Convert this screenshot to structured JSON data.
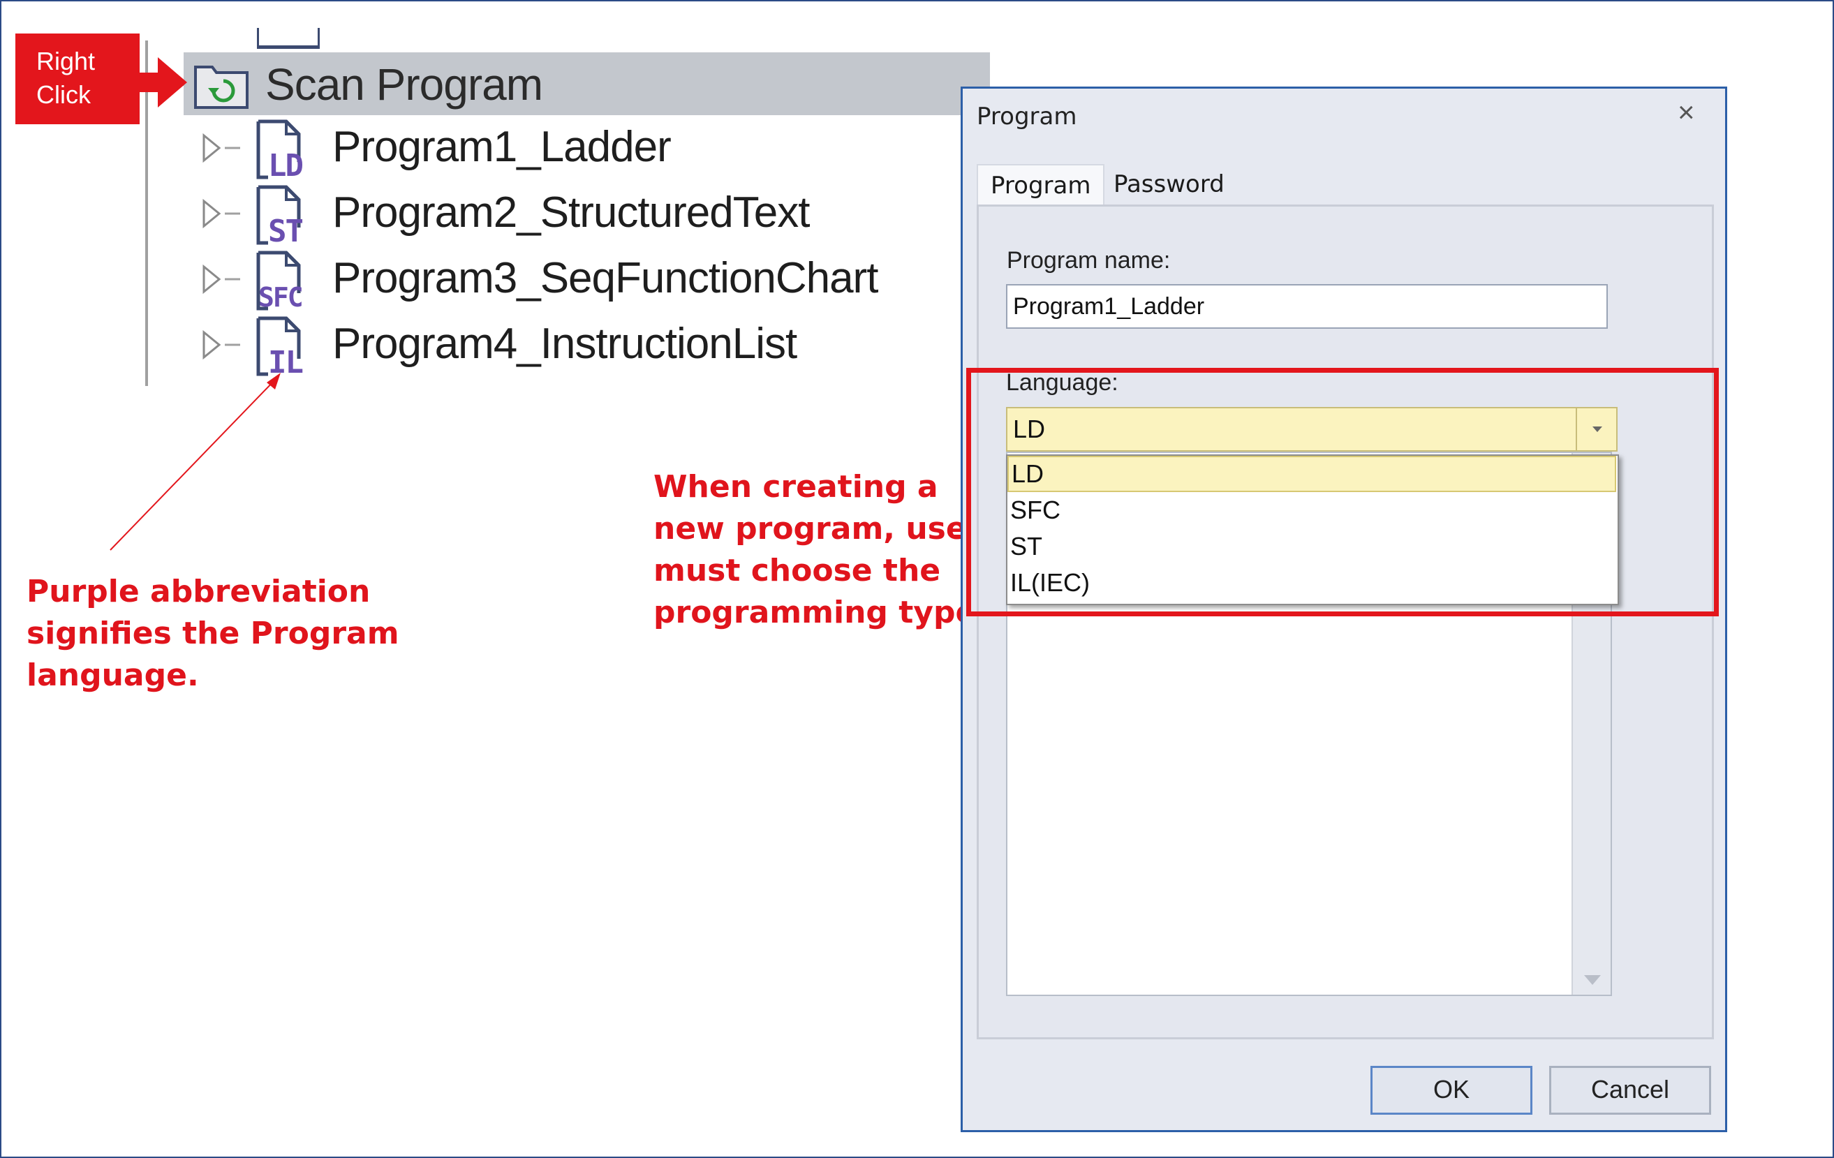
{
  "callouts": {
    "right_click": "Right\nClick",
    "language_note": "Purple abbreviation\nsignifies the Program\nlanguage.",
    "creation_note": "When creating a\nnew program, user\nmust choose the\nprogramming type"
  },
  "tree": {
    "root_label": "Scan Program",
    "programs": [
      {
        "label": "Program1_Ladder",
        "abbr": "LD"
      },
      {
        "label": "Program2_StructuredText",
        "abbr": "ST"
      },
      {
        "label": "Program3_SeqFunctionChart",
        "abbr": "SFC"
      },
      {
        "label": "Program4_InstructionList",
        "abbr": "IL"
      }
    ]
  },
  "dialog": {
    "title": "Program",
    "close_label": "×",
    "tabs": [
      {
        "label": "Program",
        "active": true
      },
      {
        "label": "Password",
        "active": false
      }
    ],
    "program_name_label": "Program name:",
    "program_name_value": "Program1_Ladder",
    "language_label": "Language:",
    "language_value": "LD",
    "language_options": [
      "LD",
      "SFC",
      "ST",
      "IL(IEC)"
    ],
    "ok_label": "OK",
    "cancel_label": "Cancel"
  },
  "colors": {
    "accent_red": "#e3161c",
    "abbr_purple": "#6a4fb0",
    "highlight_yellow": "#fbf3bf",
    "dialog_border": "#2c5fa8"
  }
}
